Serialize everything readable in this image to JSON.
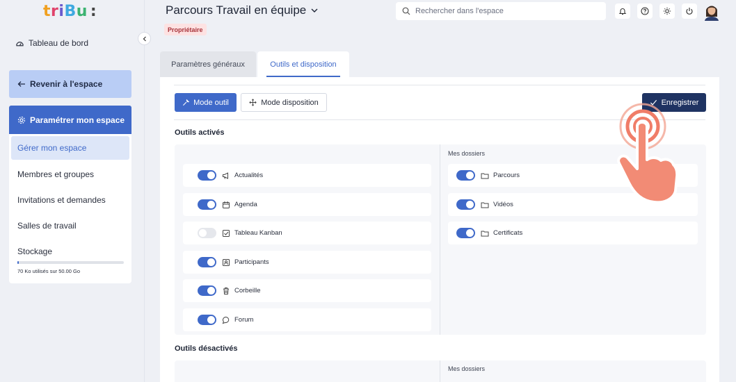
{
  "app": {
    "logo_text": "tribu:"
  },
  "sidebar": {
    "dashboard_label": "Tableau de bord",
    "back_label": "Revenir à l'espace",
    "config_label": "Paramétrer mon espace",
    "items": [
      {
        "label": "Gérer mon espace",
        "active": true
      },
      {
        "label": "Membres et groupes"
      },
      {
        "label": "Invitations et demandes"
      },
      {
        "label": "Salles de travail"
      },
      {
        "label": "Stockage"
      }
    ],
    "storage": {
      "usage_text": "70 Ko utilisés sur 50.00 Go",
      "fraction": 0.005
    }
  },
  "header": {
    "title": "Parcours Travail en équipe",
    "role_badge": "Propriétaire",
    "search_placeholder": "Rechercher dans l'espace"
  },
  "tabs": [
    {
      "label": "Paramètres généraux",
      "active": false
    },
    {
      "label": "Outils et disposition",
      "active": true
    }
  ],
  "toolbar": {
    "mode_outil": "Mode outil",
    "mode_disposition": "Mode disposition",
    "save": "Enregistrer"
  },
  "sections": {
    "enabled_title": "Outils activés",
    "disabled_title": "Outils désactivés",
    "folders_title": "Mes dossiers",
    "folders_title_2": "Mes dossiers"
  },
  "tools": [
    {
      "label": "Actualités",
      "icon": "megaphone-icon",
      "enabled": true
    },
    {
      "label": "Agenda",
      "icon": "calendar-icon",
      "enabled": true
    },
    {
      "label": "Tableau Kanban",
      "icon": "checkbox-icon",
      "enabled": false
    },
    {
      "label": "Participants",
      "icon": "contacts-icon",
      "enabled": true
    },
    {
      "label": "Corbeille",
      "icon": "trash-icon",
      "enabled": true
    },
    {
      "label": "Forum",
      "icon": "chat-icon",
      "enabled": true
    }
  ],
  "folders": [
    {
      "label": "Parcours",
      "icon": "folder-icon",
      "enabled": true
    },
    {
      "label": "Vidéos",
      "icon": "folder-icon",
      "enabled": true
    },
    {
      "label": "Certificats",
      "icon": "folder-icon",
      "enabled": true
    }
  ],
  "colors": {
    "primary": "#3f69c9",
    "save": "#1f3362",
    "badge_bg": "#fde2e2",
    "badge_text": "#a8333a"
  }
}
